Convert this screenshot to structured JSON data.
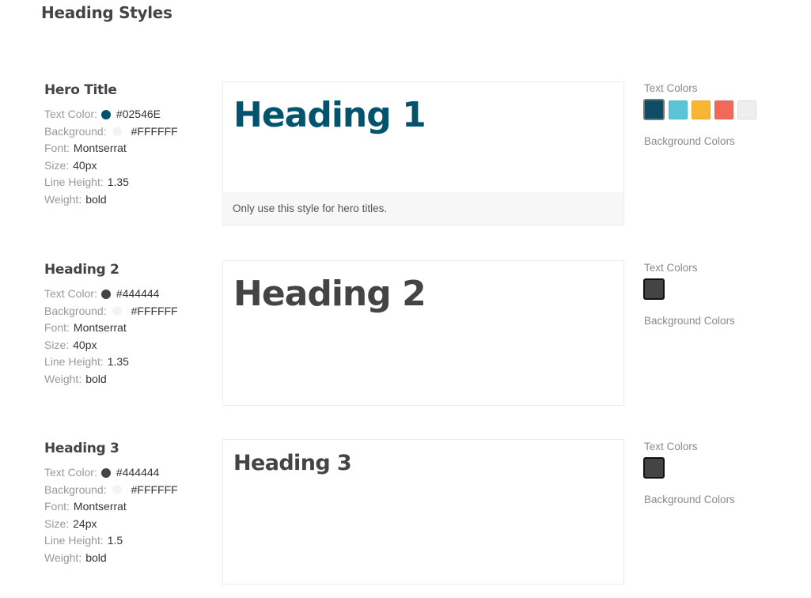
{
  "page": {
    "title": "Heading Styles"
  },
  "labels": {
    "text_color": "Text Color:",
    "background": "Background:",
    "font": "Font:",
    "size": "Size:",
    "line_height": "Line Height:",
    "weight": "Weight:",
    "text_colors": "Text Colors",
    "background_colors": "Background Colors"
  },
  "sections": [
    {
      "name": "Hero Title",
      "text_color": "#02546E",
      "background": "#FFFFFF",
      "font": "Montserrat",
      "size": "40px",
      "line_height": "1.35",
      "weight": "bold",
      "preview_text": "Heading 1",
      "note": "Only use this style for hero titles.",
      "swatches": [
        {
          "color": "#0F4D67",
          "selected": true
        },
        {
          "color": "#5BC4D6",
          "selected": false
        },
        {
          "color": "#F7B733",
          "selected": false
        },
        {
          "color": "#EF6A5A",
          "selected": false
        },
        {
          "color": "#EEEEEE",
          "selected": false
        }
      ]
    },
    {
      "name": "Heading 2",
      "text_color": "#444444",
      "background": "#FFFFFF",
      "font": "Montserrat",
      "size": "40px",
      "line_height": "1.35",
      "weight": "bold",
      "preview_text": "Heading 2",
      "swatches": [
        {
          "color": "#444444",
          "selected": true
        }
      ]
    },
    {
      "name": "Heading 3",
      "text_color": "#444444",
      "background": "#FFFFFF",
      "font": "Montserrat",
      "size": "24px",
      "line_height": "1.5",
      "weight": "bold",
      "preview_text": "Heading 3",
      "swatches": [
        {
          "color": "#444444",
          "selected": true
        }
      ]
    }
  ]
}
